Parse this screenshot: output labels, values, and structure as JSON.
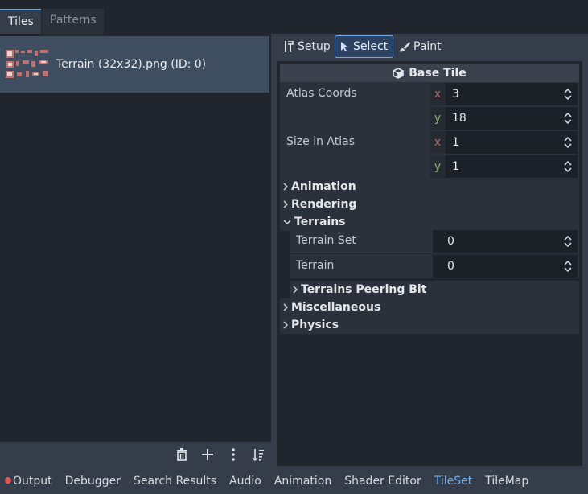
{
  "tabs": [
    {
      "label": "Tiles",
      "active": true
    },
    {
      "label": "Patterns",
      "active": false
    }
  ],
  "sources": [
    {
      "label": "Terrain (32x32).png (ID: 0)",
      "icon": "tileset-thumbnail"
    }
  ],
  "left_toolbar": [
    {
      "name": "delete-source",
      "icon": "trash-icon"
    },
    {
      "name": "add-source",
      "icon": "plus-icon"
    },
    {
      "name": "more-options",
      "icon": "kebab-icon"
    },
    {
      "name": "sort",
      "icon": "sort-icon"
    }
  ],
  "modes": [
    {
      "label": "Setup",
      "icon": "tools-icon",
      "selected": false
    },
    {
      "label": "Select",
      "icon": "cursor-icon",
      "selected": true
    },
    {
      "label": "Paint",
      "icon": "brush-icon",
      "selected": false
    }
  ],
  "inspector": {
    "header": "Base Tile",
    "atlas_coords": {
      "label": "Atlas Coords",
      "x": "3",
      "y": "18"
    },
    "size_in_atlas": {
      "label": "Size in Atlas",
      "x": "1",
      "y": "1"
    },
    "axis_x": "x",
    "axis_y": "y",
    "groups": {
      "animation": "Animation",
      "rendering": "Rendering",
      "terrains": "Terrains",
      "terrain_set_label": "Terrain Set",
      "terrain_set_value": "0",
      "terrain_label": "Terrain",
      "terrain_value": "0",
      "peering": "Terrains Peering Bit",
      "misc": "Miscellaneous",
      "physics": "Physics"
    }
  },
  "bottom_tabs": [
    {
      "label": "Output",
      "active": false,
      "alert": true
    },
    {
      "label": "Debugger",
      "active": false
    },
    {
      "label": "Search Results",
      "active": false
    },
    {
      "label": "Audio",
      "active": false
    },
    {
      "label": "Animation",
      "active": false
    },
    {
      "label": "Shader Editor",
      "active": false
    },
    {
      "label": "TileSet",
      "active": true
    },
    {
      "label": "TileMap",
      "active": false
    }
  ],
  "colors": {
    "accent": "#6fa8e8",
    "background": "#21262e",
    "panel": "#363d4a",
    "alert": "#e05555"
  }
}
